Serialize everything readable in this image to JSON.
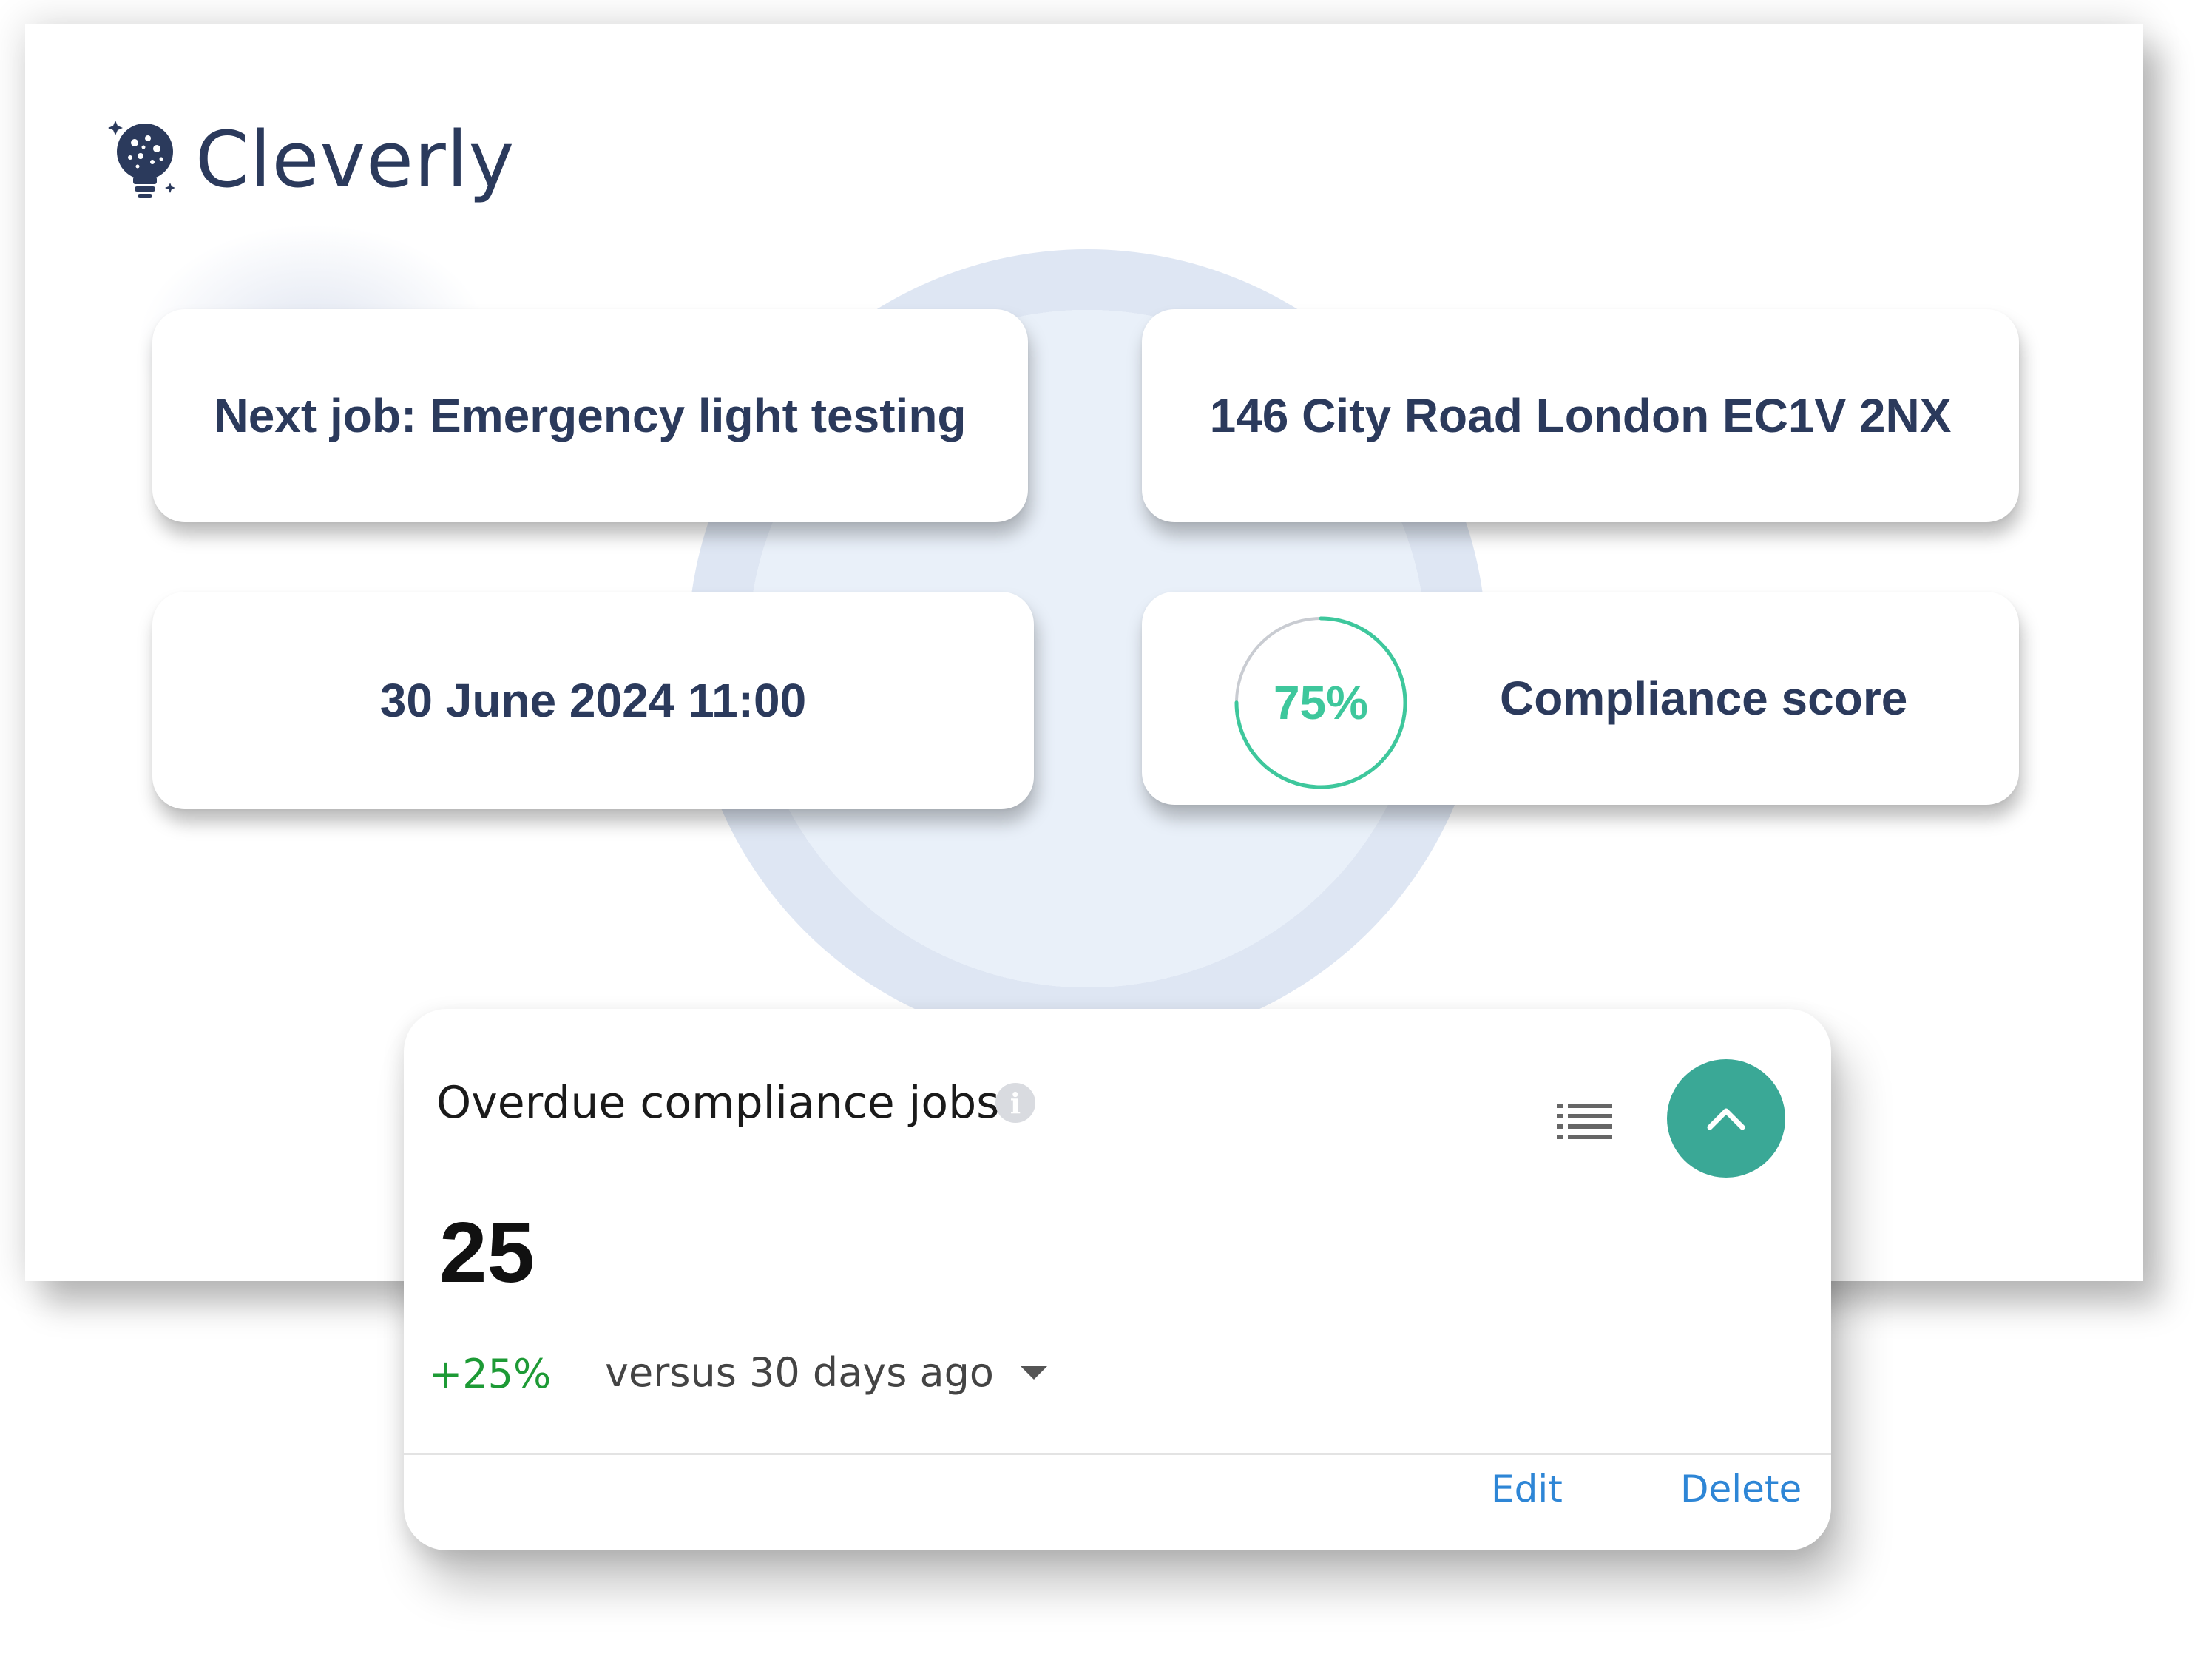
{
  "brand": {
    "name": "Cleverly",
    "logo_icon": "lightbulb-brain-icon",
    "color": "#2b3a5c"
  },
  "cards": {
    "next_job": "Next job: Emergency light testing",
    "address": "146 City Road London EC1V 2NX",
    "datetime": "30 June 2024 11:00",
    "compliance": {
      "value": "75%",
      "label": "Compliance score",
      "fraction": 0.75,
      "color": "#3ec79c"
    }
  },
  "widget": {
    "title": "Overdue compliance jobs",
    "info_icon": "info-icon",
    "list_icon": "list-view-icon",
    "collapse_icon": "chevron-up-icon",
    "count": "25",
    "change": "+25%",
    "comparison": "versus 30 days ago",
    "edit_label": "Edit",
    "delete_label": "Delete",
    "accent_color": "#3aa896",
    "link_color": "#2e86d6",
    "positive_color": "#1d9a35"
  }
}
